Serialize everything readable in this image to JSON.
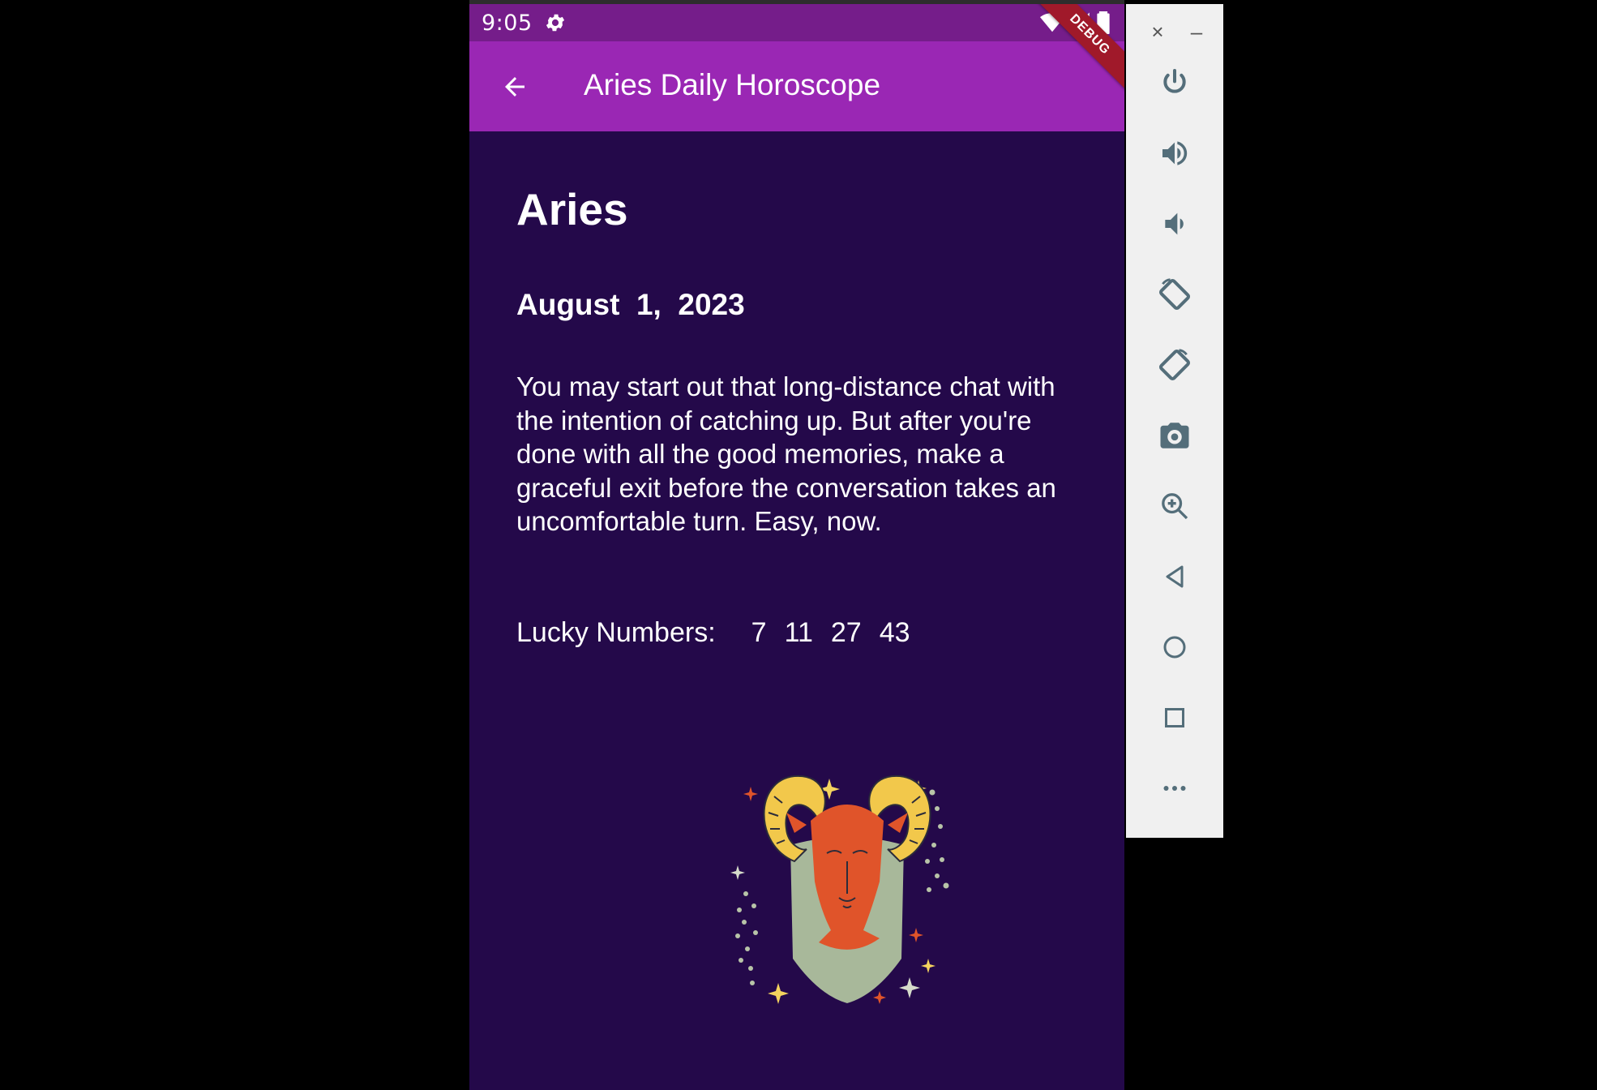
{
  "status_bar": {
    "time": "9:05",
    "background": "#751d8a"
  },
  "app_bar": {
    "title": "Aries Daily Horoscope",
    "background": "#9a27b4",
    "debug_banner": "DEBUG"
  },
  "content": {
    "background": "#24094a",
    "sign": "Aries",
    "date": "August  1,  2023",
    "horoscope": "You may start out that long-distance chat with the intention of catching up. But after you're done with all the good memories, make a graceful exit before the conversation takes an uncomfortable turn. Easy, now.",
    "lucky_label": "Lucky Numbers:",
    "lucky_numbers": [
      "7",
      "11",
      "27",
      "43"
    ]
  },
  "emulator_panel": {
    "close_symbol": "×",
    "minimize_symbol": "–",
    "buttons": [
      "power-icon",
      "volume-up-icon",
      "volume-down-icon",
      "rotate-left-icon",
      "rotate-right-icon",
      "camera-icon",
      "zoom-icon",
      "back-icon",
      "home-icon",
      "overview-icon",
      "more-icon"
    ],
    "icon_color": "#546e7a"
  }
}
